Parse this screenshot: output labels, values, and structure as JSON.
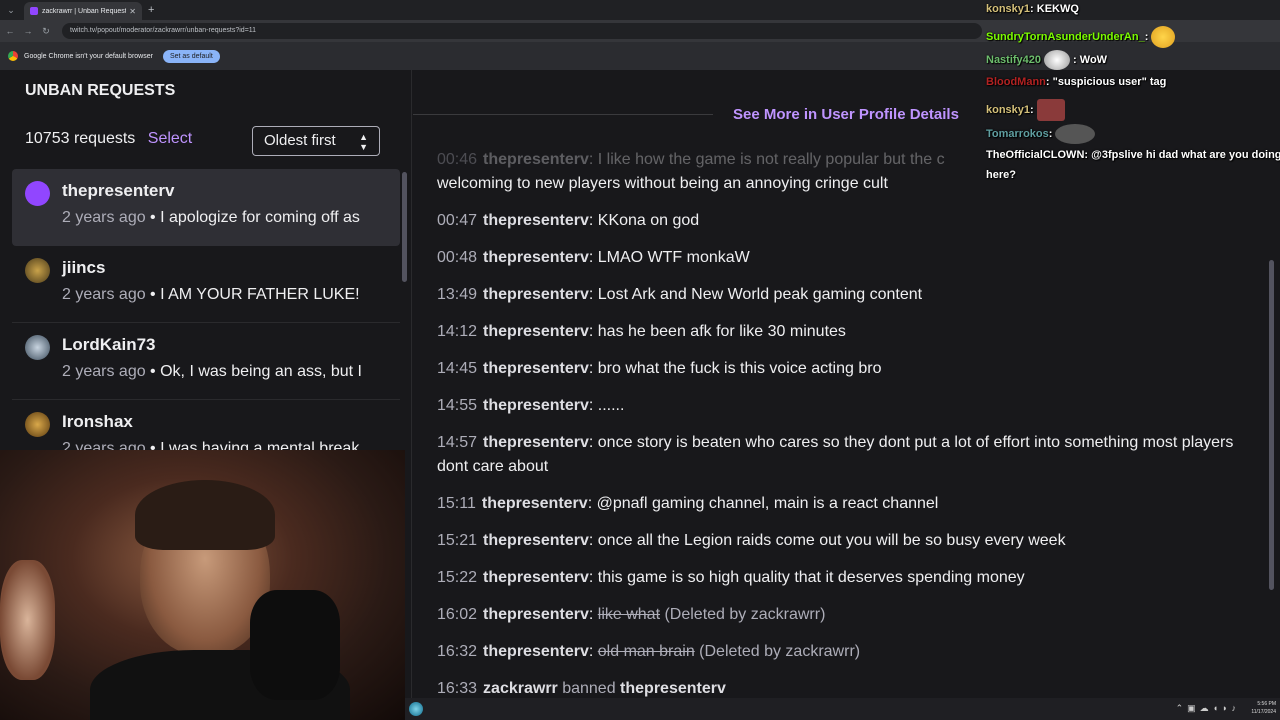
{
  "browser": {
    "tab_title": "zackrawrr | Unban Requests - T",
    "tab_close": "✕",
    "new_tab": "+",
    "url": "twitch.tv/popout/moderator/zackrawrr/unban-requests?id=11",
    "info_text": "Google Chrome isn't your default browser",
    "set_default": "Set as default"
  },
  "header": {
    "title": "UNBAN REQUESTS"
  },
  "list": {
    "count": "10753 requests",
    "select": "Select",
    "sort": "Oldest first",
    "items": [
      {
        "user": "thepresenterv",
        "ago": "2 years ago",
        "sep": " • ",
        "text": "I apologize for coming off as"
      },
      {
        "user": "jiincs",
        "ago": "2 years ago",
        "sep": " • ",
        "text": "I AM YOUR FATHER LUKE!"
      },
      {
        "user": "LordKain73",
        "ago": "2 years ago",
        "sep": " • ",
        "text": "Ok, I was being an ass, but I"
      },
      {
        "user": "Ironshax",
        "ago": "2 years ago",
        "sep": " • ",
        "text": "I was having a mental break"
      }
    ]
  },
  "detail": {
    "see_more": "See More in User Profile Details",
    "messages": [
      {
        "ts": "00:46",
        "user": "thepresenterv",
        "text": ": I like how the game is not really popular but the c"
      },
      {
        "ts": "",
        "user": "",
        "text": "welcoming to new players without being an annoying cringe cult"
      },
      {
        "ts": "00:47",
        "user": "thepresenterv",
        "text": ": KKona on god"
      },
      {
        "ts": "00:48",
        "user": "thepresenterv",
        "text": ": LMAO WTF monkaW"
      },
      {
        "ts": "13:49",
        "user": "thepresenterv",
        "text": ": Lost Ark and New World peak gaming content"
      },
      {
        "ts": "14:12",
        "user": "thepresenterv",
        "text": ": has he been afk for like 30 minutes"
      },
      {
        "ts": "14:45",
        "user": "thepresenterv",
        "text": ": bro what the fuck is this voice acting bro"
      },
      {
        "ts": "14:55",
        "user": "thepresenterv",
        "text": ": ......"
      },
      {
        "ts": "14:57",
        "user": "thepresenterv",
        "text": ": once story is beaten who cares so they dont put a lot of effort into something most players dont care about"
      },
      {
        "ts": "15:11",
        "user": "thepresenterv",
        "text": ": @pnafl gaming channel, main is a react channel"
      },
      {
        "ts": "15:21",
        "user": "thepresenterv",
        "text": ": once all the Legion raids come out you will be so busy every week"
      },
      {
        "ts": "15:22",
        "user": "thepresenterv",
        "text": ": this game is so high quality that it deserves spending money"
      }
    ],
    "deleted": [
      {
        "ts": "16:02",
        "user": "thepresenterv",
        "colon": ": ",
        "text": "like what",
        "note": " (Deleted by zackrawrr)"
      },
      {
        "ts": "16:32",
        "user": "thepresenterv",
        "colon": ": ",
        "text": "old man brain",
        "note": " (Deleted by zackrawrr)"
      }
    ],
    "ban": {
      "ts": "16:33",
      "mod": "zackrawrr",
      "action": " banned ",
      "target": "thepresenterv"
    }
  },
  "overlay_chat": [
    {
      "user": "konsky1",
      "text": ": KEKWQ",
      "color": "#d4c07a"
    },
    {
      "user": "SundryTornAsunderUnderAn_",
      "text": ":",
      "color": "#7cfc00"
    },
    {
      "user": "Nastify420",
      "text": ": WoW",
      "color": "#6dbd6d"
    },
    {
      "user": "BloodMann",
      "text": ": \"suspicious user\" tag",
      "color": "#b22222"
    },
    {
      "user": "konsky1",
      "text": ":",
      "color": "#d4c07a"
    },
    {
      "user": "Tomarrokos",
      "text": ":",
      "color": "#5f9ea0"
    },
    {
      "user": "TheOfficialCLOWN",
      "text": ": @3fpslive hi dad what are you doing",
      "color": "#ffffff"
    },
    {
      "user": "",
      "text": "here?",
      "color": "#ffffff"
    }
  ],
  "taskbar": {
    "time": "5:56 PM",
    "date": "11/17/2024"
  }
}
